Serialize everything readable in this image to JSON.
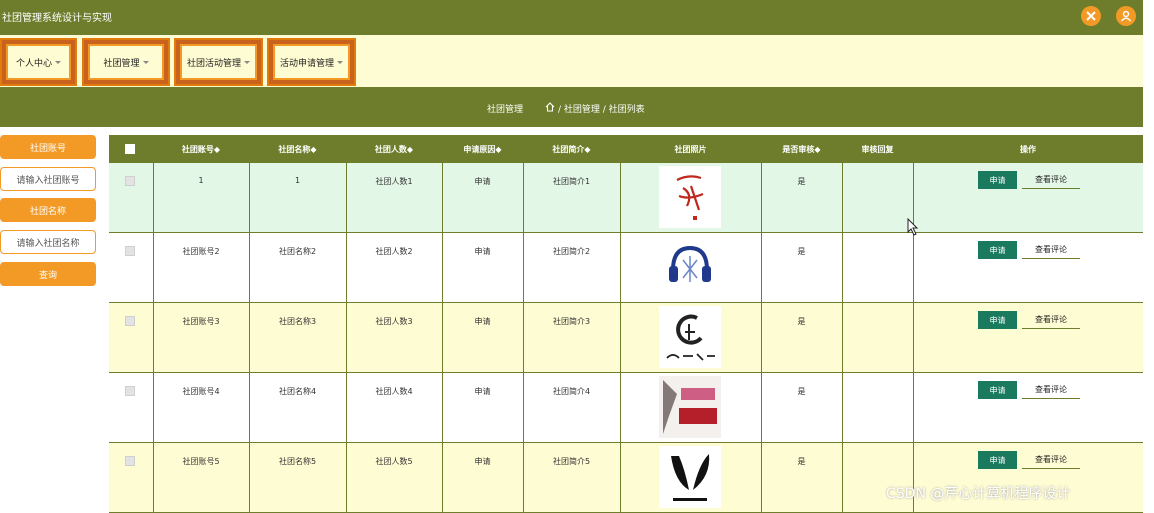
{
  "app": {
    "title": "社团管理系统设计与实现"
  },
  "nav": {
    "items": [
      {
        "label": "个人中心"
      },
      {
        "label": "社团管理"
      },
      {
        "label": "社团活动管理"
      },
      {
        "label": "活动申请管理"
      }
    ]
  },
  "breadcrumb": {
    "title": "社团管理",
    "path": "/ 社团管理 / 社团列表"
  },
  "sidebar": {
    "account_label": "社团账号",
    "account_placeholder": "请输入社团账号",
    "name_label": "社团名称",
    "name_placeholder": "请输入社团名称",
    "search_label": "查询"
  },
  "table": {
    "headers": [
      "社团账号◆",
      "社团名称◆",
      "社团人数◆",
      "申请原因◆",
      "社团简介◆",
      "社团照片",
      "是否审核◆",
      "审核回复",
      "操作"
    ],
    "rows": [
      {
        "account": "1",
        "name": "1",
        "count": "社团人数1",
        "reason": "申请",
        "intro": "社团简介1",
        "audit": "是",
        "reply": ""
      },
      {
        "account": "社团账号2",
        "name": "社团名称2",
        "count": "社团人数2",
        "reason": "申请",
        "intro": "社团简介2",
        "audit": "是",
        "reply": ""
      },
      {
        "account": "社团账号3",
        "name": "社团名称3",
        "count": "社团人数3",
        "reason": "申请",
        "intro": "社团简介3",
        "audit": "是",
        "reply": ""
      },
      {
        "account": "社团账号4",
        "name": "社团名称4",
        "count": "社团人数4",
        "reason": "申请",
        "intro": "社团简介4",
        "audit": "是",
        "reply": ""
      },
      {
        "account": "社团账号5",
        "name": "社团名称5",
        "count": "社团人数5",
        "reason": "申请",
        "intro": "社团简介5",
        "audit": "是",
        "reply": ""
      }
    ],
    "apply_label": "申请",
    "review_label": "查看评论"
  },
  "watermark": "CSDN @芹心计算机程序设计",
  "colors": {
    "primary": "#6d7d2b",
    "accent": "#f39a26",
    "nav_bg": "#fefcd2",
    "row_green": "#e3f7e6",
    "row_yellow": "#fefcd2",
    "apply_btn": "#1a7a5e"
  },
  "icons": [
    "close-icon",
    "user-icon",
    "home-icon"
  ]
}
